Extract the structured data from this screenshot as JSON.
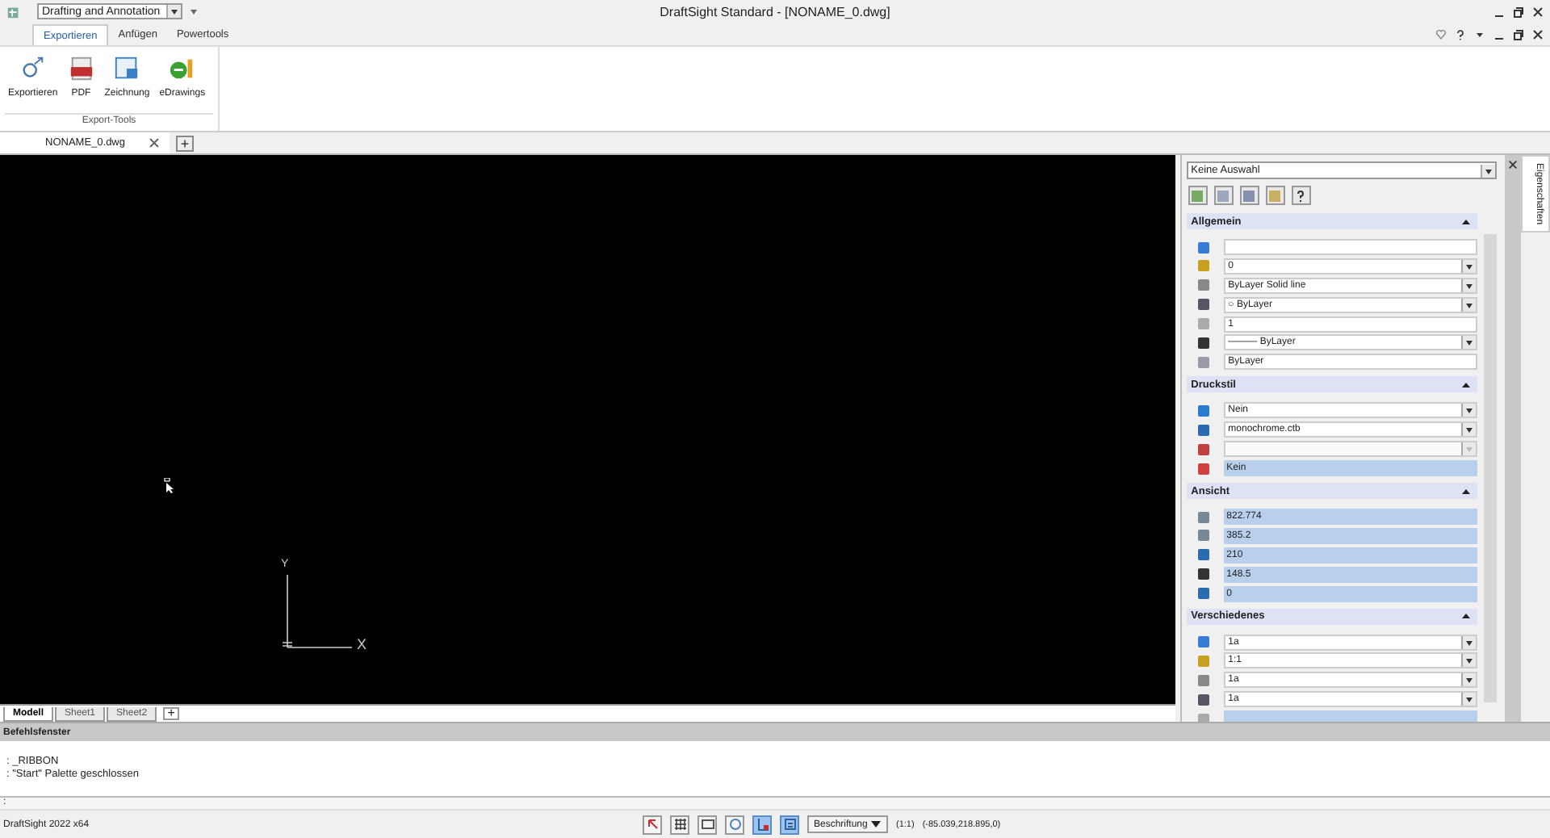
{
  "window": {
    "title": "DraftSight Standard - [NONAME_0.dwg]",
    "workspace": "Drafting and Annotation"
  },
  "ribbon": {
    "tabs": [
      {
        "label": "Exportieren",
        "selected": true
      },
      {
        "label": "Anfügen",
        "selected": false
      },
      {
        "label": "Powertools",
        "selected": false
      }
    ],
    "buttons": [
      {
        "label": "Exportieren",
        "kind": "export"
      },
      {
        "label": "PDF",
        "kind": "pdf"
      },
      {
        "label": "Zeichnung",
        "kind": "drawing"
      },
      {
        "label": "eDrawings",
        "kind": "edrawings"
      }
    ],
    "group": "Export-Tools"
  },
  "documents": [
    {
      "label": "NONAME_0.dwg",
      "selected": true
    }
  ],
  "new_tab": "+",
  "ucs": {
    "y": "Y",
    "x": "X"
  },
  "layouts": [
    {
      "label": "Modell",
      "selected": true
    },
    {
      "label": "Sheet1",
      "selected": false
    },
    {
      "label": "Sheet2",
      "selected": false
    }
  ],
  "new_layout": "+",
  "command_window": {
    "title": "Befehlsfenster",
    "lines": [
      ": _RIBBON",
      ": \"Start\" Palette geschlossen"
    ],
    "prompt": ":"
  },
  "properties": {
    "selection": "Keine Auswahl",
    "side_tab": "Eigenschaften",
    "sections": [
      {
        "title": "Allgemein",
        "expanded": true,
        "rows": [
          {
            "kind": "text",
            "value": ""
          },
          {
            "kind": "dropdown",
            "value": "0"
          },
          {
            "kind": "dropdown",
            "value": "ByLayer    Solid line"
          },
          {
            "kind": "dropdown",
            "value": "○ ByLayer"
          },
          {
            "kind": "text",
            "value": "1"
          },
          {
            "kind": "dropdown",
            "value": "——— ByLayer"
          },
          {
            "kind": "text",
            "value": "ByLayer"
          }
        ]
      },
      {
        "title": "Druckstil",
        "expanded": true,
        "rows": [
          {
            "kind": "dropdown",
            "value": "Nein"
          },
          {
            "kind": "dropdown",
            "value": "monochrome.ctb"
          },
          {
            "kind": "dropdown-disabled",
            "value": ""
          },
          {
            "kind": "readonly",
            "value": "Kein"
          }
        ]
      },
      {
        "title": "Ansicht",
        "expanded": true,
        "rows": [
          {
            "kind": "readonly",
            "value": "822.774"
          },
          {
            "kind": "readonly",
            "value": "385.2"
          },
          {
            "kind": "readonly",
            "value": "210"
          },
          {
            "kind": "readonly",
            "value": "148.5"
          },
          {
            "kind": "readonly",
            "value": "0"
          }
        ]
      },
      {
        "title": "Verschiedenes",
        "expanded": true,
        "rows": [
          {
            "kind": "dropdown",
            "value": "1a"
          },
          {
            "kind": "dropdown",
            "value": "1:1"
          },
          {
            "kind": "dropdown",
            "value": "1a"
          },
          {
            "kind": "dropdown",
            "value": "1a"
          },
          {
            "kind": "readonly",
            "value": ""
          }
        ]
      }
    ]
  },
  "status_bar": {
    "app": "DraftSight 2022 x64",
    "toggles": [
      {
        "selected": false
      },
      {
        "selected": false
      },
      {
        "selected": false
      },
      {
        "selected": false
      },
      {
        "selected": true
      },
      {
        "selected": true
      }
    ],
    "annotation": "Beschriftung",
    "scale": "(1:1)",
    "coordinates": "(-85.039,218.895,0)"
  }
}
